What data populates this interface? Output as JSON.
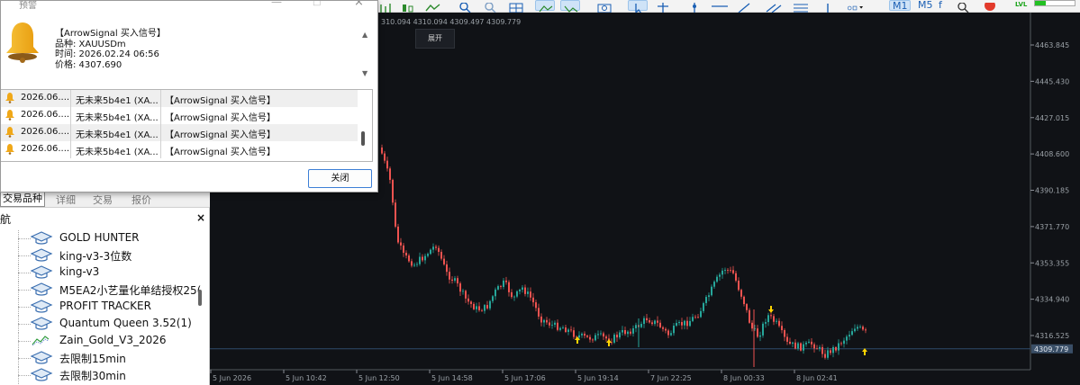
{
  "dialog": {
    "title": "预警",
    "message": {
      "line1": "【ArrowSignal 买入信号】",
      "line2": "品种: XAUUSDm",
      "line3": "时间: 2026.02.24 06:56",
      "line4": "价格: 4307.690"
    },
    "alerts": [
      {
        "time": "2026.06....",
        "source": "无未来5b4e1 (XA...",
        "message": "【ArrowSignal 买入信号】"
      },
      {
        "time": "2026.06....",
        "source": "无未来5b4e1 (XA...",
        "message": "【ArrowSignal 买入信号】"
      },
      {
        "time": "2026.06....",
        "source": "无未来5b4e1 (XA...",
        "message": "【ArrowSignal 买入信号】"
      },
      {
        "time": "2026.06....",
        "source": "无未来5b4e1 (XA...",
        "message": "【ArrowSignal 买入信号】"
      }
    ],
    "close_label": "关闭"
  },
  "toolbar": {
    "timeframes": [
      "M1",
      "M5"
    ],
    "level_label": "LVL"
  },
  "navigator": {
    "tabs": [
      "交易品种",
      "详细",
      "交易",
      "报价"
    ],
    "title": "航",
    "close_symbol": "×",
    "items": [
      {
        "label": "GOLD HUNTER",
        "icon": "expert-hat-icon"
      },
      {
        "label": "king-v3-3位数",
        "icon": "expert-hat-icon"
      },
      {
        "label": "king-v3",
        "icon": "expert-hat-icon"
      },
      {
        "label": "M5EA2小艺量化单结授权25(",
        "icon": "expert-hat-icon"
      },
      {
        "label": "PROFIT TRACKER",
        "icon": "expert-hat-icon"
      },
      {
        "label": "Quantum Queen 3.52(1)",
        "icon": "expert-hat-icon"
      },
      {
        "label": "Zain_Gold_V3_2026",
        "icon": "indicator-line-icon"
      },
      {
        "label": "去限制15min",
        "icon": "expert-hat-icon"
      },
      {
        "label": "去限制30min",
        "icon": "expert-hat-icon"
      }
    ]
  },
  "chart": {
    "header_text": "310.094 4310.094 4309.497 4309.779",
    "expand_label": "展开",
    "current_price": "4309.779",
    "price_ticks": [
      "4463.845",
      "4445.430",
      "4427.015",
      "4408.600",
      "4390.185",
      "4371.770",
      "4353.355",
      "4334.940",
      "4316.525"
    ],
    "time_ticks": [
      "5 Jun 2026",
      "5 Jun 10:42",
      "5 Jun 12:50",
      "5 Jun 14:58",
      "5 Jun 17:06",
      "5 Jun 19:14",
      "7 Jun 22:25",
      "8 Jun 00:33",
      "8 Jun 02:41"
    ],
    "colors": {
      "background": "#101216",
      "bull": "#26a69a",
      "bear": "#ef5350",
      "arrow": "#ffd400",
      "price_line": "#2e4a6b"
    }
  }
}
